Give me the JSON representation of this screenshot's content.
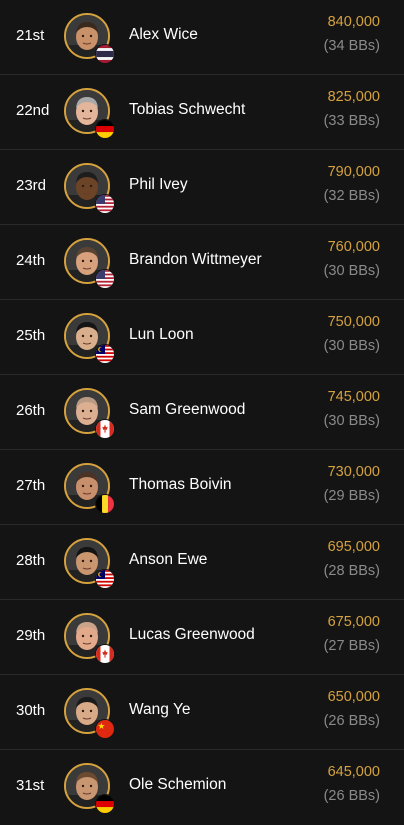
{
  "colors": {
    "background": "#141414",
    "accent_gold": "#d6a23e",
    "muted_text": "#8a8a8a",
    "divider": "#2a2a2a"
  },
  "players": [
    {
      "rank": "21st",
      "name": "Alex Wice",
      "chips": "840,000",
      "bbs": "(34 BBs)",
      "flag": "thailand-flag-icon",
      "skin": "#c9916a",
      "hair": "#3a2a1e"
    },
    {
      "rank": "22nd",
      "name": "Tobias Schwecht",
      "chips": "825,000",
      "bbs": "(33 BBs)",
      "flag": "germany-flag-icon",
      "skin": "#e3b59a",
      "hair": "#a9a9a9"
    },
    {
      "rank": "23rd",
      "name": "Phil Ivey",
      "chips": "790,000",
      "bbs": "(32 BBs)",
      "flag": "usa-flag-icon",
      "skin": "#6b4428",
      "hair": "#1d1d1d"
    },
    {
      "rank": "24th",
      "name": "Brandon Wittmeyer",
      "chips": "760,000",
      "bbs": "(30 BBs)",
      "flag": "usa-flag-icon",
      "skin": "#d7a17d",
      "hair": "#5a4434"
    },
    {
      "rank": "25th",
      "name": "Lun Loon",
      "chips": "750,000",
      "bbs": "(30 BBs)",
      "flag": "malaysia-flag-icon",
      "skin": "#d9ae8c",
      "hair": "#151515"
    },
    {
      "rank": "26th",
      "name": "Sam Greenwood",
      "chips": "745,000",
      "bbs": "(30 BBs)",
      "flag": "canada-flag-icon",
      "skin": "#dcae92",
      "hair": "#b99a84"
    },
    {
      "rank": "27th",
      "name": "Thomas Boivin",
      "chips": "730,000",
      "bbs": "(29 BBs)",
      "flag": "belgium-flag-icon",
      "skin": "#c88f6c",
      "hair": "#4a3324"
    },
    {
      "rank": "28th",
      "name": "Anson Ewe",
      "chips": "695,000",
      "bbs": "(28 BBs)",
      "flag": "malaysia-flag-icon",
      "skin": "#c99670",
      "hair": "#141414"
    },
    {
      "rank": "29th",
      "name": "Lucas Greenwood",
      "chips": "675,000",
      "bbs": "(27 BBs)",
      "flag": "canada-flag-icon",
      "skin": "#e2a98a",
      "hair": "#c9a38a"
    },
    {
      "rank": "30th",
      "name": "Wang Ye",
      "chips": "650,000",
      "bbs": "(26 BBs)",
      "flag": "china-flag-icon",
      "skin": "#d8aa88",
      "hair": "#1b1b1b"
    },
    {
      "rank": "31st",
      "name": "Ole Schemion",
      "chips": "645,000",
      "bbs": "(26 BBs)",
      "flag": "germany-flag-icon",
      "skin": "#c99672",
      "hair": "#6b4a30"
    }
  ]
}
